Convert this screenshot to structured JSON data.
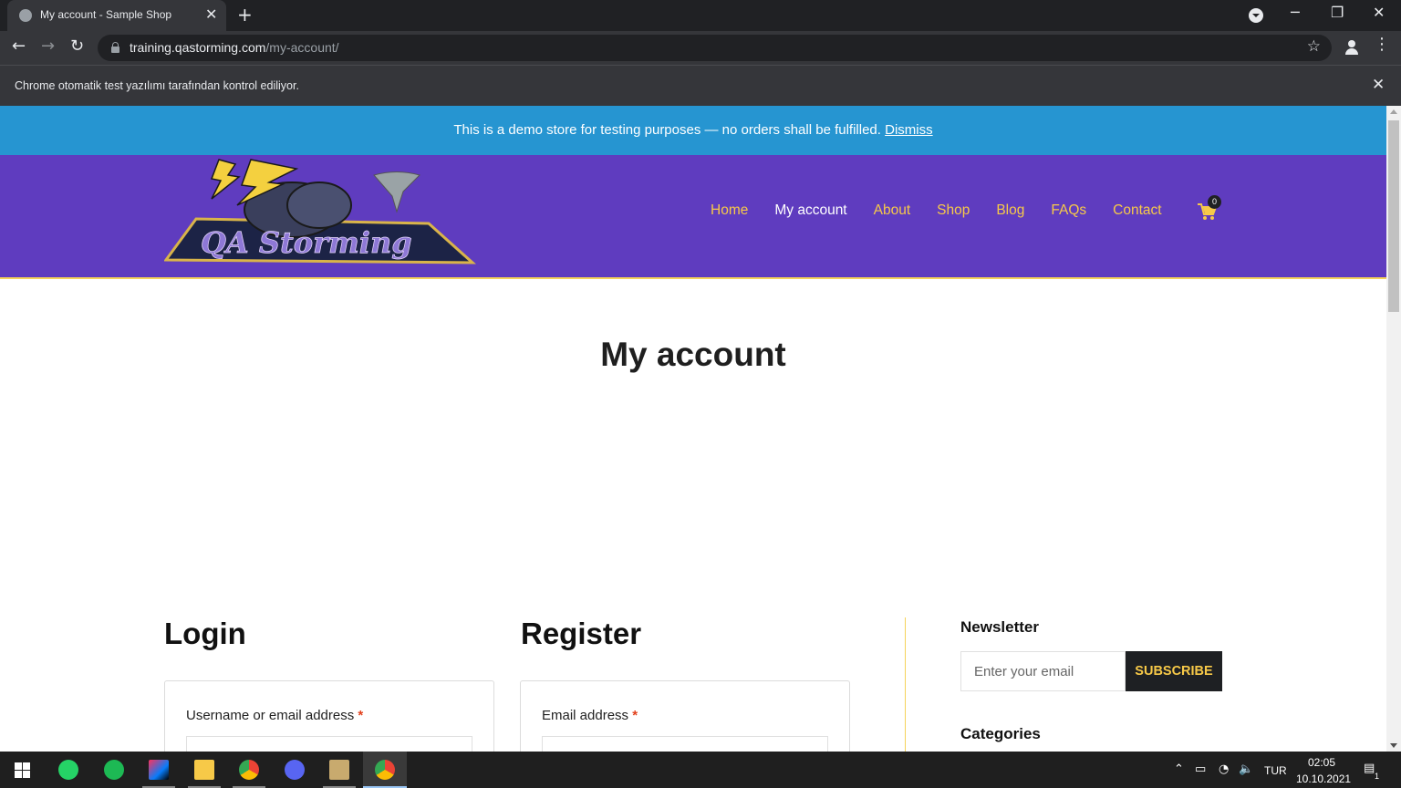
{
  "browser": {
    "tab_title": "My account - Sample Shop",
    "tab_close": "✕",
    "new_tab": "+",
    "url_host": "training.qastorming.com",
    "url_path": "/my-account/",
    "infobar_text": "Chrome otomatik test yazılımı tarafından kontrol ediliyor.",
    "infobar_close": "✕",
    "back": "←",
    "forward": "→",
    "reload": "↻",
    "star": "☆",
    "minimize": "─",
    "restore": "❐",
    "close": "✕"
  },
  "notice": {
    "text": "This is a demo store for testing purposes — no orders shall be fulfilled.",
    "dismiss": "Dismiss",
    "color": "#2695d1"
  },
  "header": {
    "logo_text": "QA Storming",
    "nav": [
      "Home",
      "My account",
      "About",
      "Shop",
      "Blog",
      "FAQs",
      "Contact"
    ],
    "active_nav": "My account",
    "cart_count": "0",
    "bg_color": "#5f3cbf",
    "accent_color": "#f7c948"
  },
  "page": {
    "title": "My account"
  },
  "login": {
    "title": "Login",
    "username_label": "Username or email address",
    "required_mark": "*"
  },
  "register": {
    "title": "Register",
    "email_label": "Email address",
    "required_mark": "*"
  },
  "sidebar": {
    "newsletter_title": "Newsletter",
    "email_placeholder": "Enter your email",
    "subscribe_label": "SUBSCRIBE",
    "categories_title": "Categories"
  },
  "taskbar": {
    "apps": [
      "whatsapp-icon",
      "spotify-icon",
      "intellij-icon",
      "file-explorer-icon",
      "chrome-icon",
      "discord-icon",
      "league-of-legends-icon",
      "chrome-icon"
    ],
    "language": "TUR",
    "time": "02:05",
    "date": "10.10.2021",
    "notification_count": "1"
  }
}
